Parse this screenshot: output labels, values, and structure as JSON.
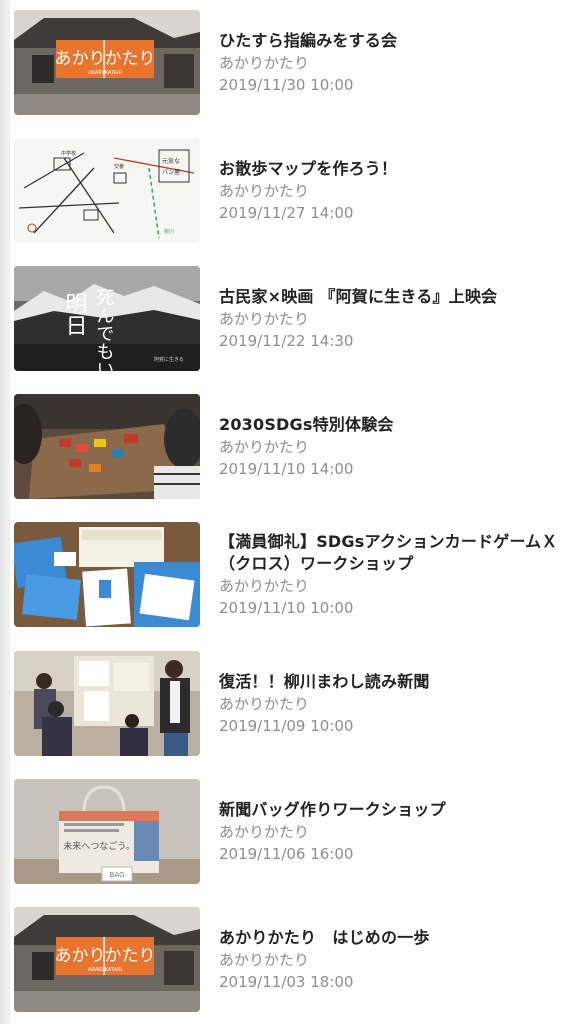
{
  "events": [
    {
      "title": "ひたすら指編みをする会",
      "organizer": "あかりかたり",
      "datetime": "2019/11/30 10:00",
      "thumbnail_icon": "akari-katari-logo-house-photo"
    },
    {
      "title": "お散歩マップを作ろう！",
      "organizer": "あかりかたり",
      "datetime": "2019/11/27 14:00",
      "thumbnail_icon": "hand-drawn-map"
    },
    {
      "title": "古民家×映画 『阿賀に生きる』上映会",
      "organizer": "あかりかたり",
      "datetime": "2019/11/22 14:30",
      "thumbnail_icon": "movie-poster-mountains"
    },
    {
      "title": "2030SDGs特別体験会",
      "organizer": "あかりかたり",
      "datetime": "2019/11/10 14:00",
      "thumbnail_icon": "board-game-photo"
    },
    {
      "title": "【満員御礼】SDGsアクションカードゲームＸ（クロス）ワークショップ",
      "title_line1": "【満員御礼】SDGsアクションカードゲームＸ",
      "title_line2": "（クロス）ワークショップ",
      "organizer": "あかりかたり",
      "datetime": "2019/11/10 10:00",
      "thumbnail_icon": "card-game-photo"
    },
    {
      "title": "復活！！柳川まわし読み新聞",
      "organizer": "あかりかたり",
      "datetime": "2019/11/09 10:00",
      "thumbnail_icon": "newspaper-group-photo"
    },
    {
      "title": "新聞バッグ作りワークショップ",
      "organizer": "あかりかたり",
      "datetime": "2019/11/06 16:00",
      "thumbnail_icon": "newspaper-bag-photo"
    },
    {
      "title": "あかりかたり　はじめの一歩",
      "organizer": "あかりかたり",
      "datetime": "2019/11/03 18:00",
      "thumbnail_icon": "akari-katari-logo-house-photo"
    }
  ],
  "logo_text": {
    "line1": "あかり",
    "line2": "かたり",
    "sub": "AKARI KATARI"
  },
  "map_text": {
    "a": "中学校",
    "b": "交番",
    "c": "元気な",
    "d": "パン屋",
    "e": "柳川"
  },
  "poster_text": {
    "big1": "明日",
    "big2": "死んでもいい",
    "small": "阿賀に生きる"
  },
  "bag_text": {
    "print": "未来へつなごう。",
    "tag": "BAG"
  },
  "colors": {
    "title": "#222222",
    "meta": "#8e8e8e",
    "logo_orange": "#e8742e"
  }
}
